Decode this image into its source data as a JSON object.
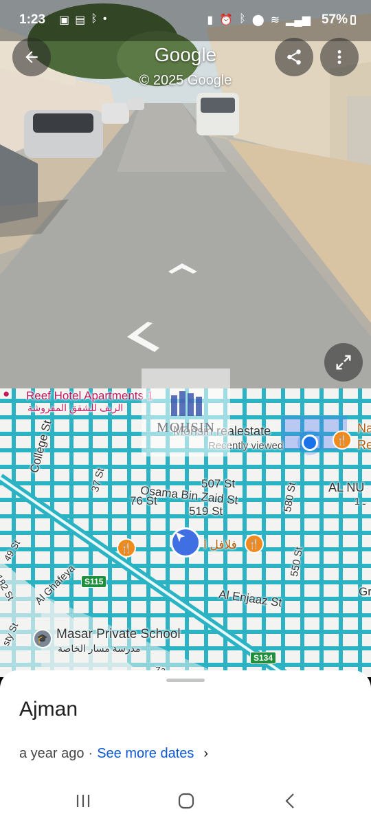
{
  "status_bar": {
    "time": "1:23",
    "battery": "57%"
  },
  "street_view": {
    "title": "Google",
    "copyright": "© 2025 Google"
  },
  "map": {
    "labels": {
      "reef_hotel": "Reef Hotel Apartments 1",
      "reef_hotel_ar": "الريف للشقق المفروشة",
      "mohsin": "Mohsin realestate",
      "recently_viewed": "Recently viewed",
      "college_st": "College St",
      "st_37": "37 St",
      "st_507": "507 St",
      "osama": "Osama Bin Zaid St",
      "st_76": "76 St",
      "st_519": "519 St",
      "st_580": "580 St",
      "al_nu": "AL NU",
      "st_49": "49 St",
      "st_182": "182 St",
      "al_ghafeya": "Al Ghafeya",
      "falafel": "فلافل ا",
      "st_550": "550 St",
      "al_enjaaz": "Al Enjaaz St",
      "masar": "Masar Private School",
      "masar_ar": "مدرسة مسار الخاصة",
      "n_right": "Na",
      "re_right": "Re",
      "gr_right": "Gr",
      "sty_st": "sty St",
      "one_frag": "1 ـ",
      "z3": "Za"
    },
    "badges": {
      "s115": "S115",
      "s134": "S134"
    }
  },
  "watermark": {
    "text": "MOHSIN"
  },
  "sheet": {
    "place": "Ajman",
    "age": "a year ago",
    "separator": "·",
    "see_more": "See more dates",
    "chevron": "›"
  },
  "icons": {
    "back": "arrow-left-icon",
    "share": "share-icon",
    "more": "more-vert-icon",
    "expand": "expand-icon",
    "food": "restaurant-icon",
    "school": "school-icon",
    "location": "my-location-icon",
    "navigation": "navigation-arrow-icon"
  },
  "colors": {
    "road": "#2bb3c4",
    "blue_dot": "#1a73e8",
    "food_pin": "#f18a1c",
    "link": "#0b57d0",
    "highway_badge": "#1e8f3b"
  }
}
